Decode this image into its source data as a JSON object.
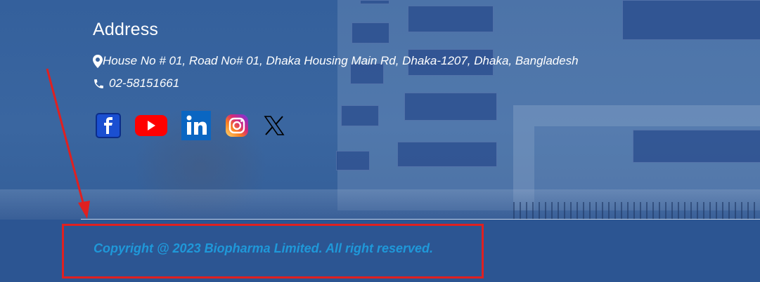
{
  "footer": {
    "address_heading": "Address",
    "address_text": "House No # 01, Road No# 01, Dhaka Housing Main Rd, Dhaka-1207, Dhaka, Bangladesh",
    "phone": "02-58151661",
    "social": [
      {
        "name": "facebook",
        "icon": "facebook-icon",
        "color": "#1a56d6"
      },
      {
        "name": "youtube",
        "icon": "youtube-icon",
        "color": "#ff0000"
      },
      {
        "name": "linkedin",
        "icon": "linkedin-icon",
        "color": "#0a66c2"
      },
      {
        "name": "instagram",
        "icon": "instagram-icon",
        "color": "#d62976"
      },
      {
        "name": "x",
        "icon": "x-icon",
        "color": "#000000"
      }
    ],
    "copyright": "Copyright @ 2023 Biopharma Limited. All right reserved."
  },
  "annotation": {
    "color": "#e02020",
    "type": "arrow-and-box highlighting copyright"
  },
  "colors": {
    "background": "#2c5593",
    "copyright_text": "#1f98d9",
    "text": "#ffffff"
  }
}
